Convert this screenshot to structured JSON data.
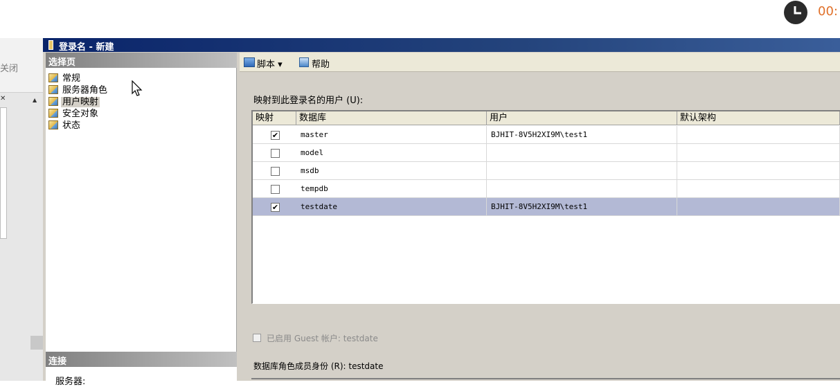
{
  "overlay": {
    "clock_text": "00:"
  },
  "host": {
    "close_label": "关闭",
    "x_label": "✕",
    "scroll_up": "▲"
  },
  "dialog": {
    "title": "登录名 - 新建",
    "select_page_header": "选择页",
    "pages": [
      {
        "label": "常规"
      },
      {
        "label": "服务器角色"
      },
      {
        "label": "用户映射"
      },
      {
        "label": "安全对象"
      },
      {
        "label": "状态"
      }
    ],
    "selected_page": "用户映射",
    "connection_header": "连接",
    "server_label": "服务器:"
  },
  "toolbar": {
    "script_label": "脚本 ▾",
    "help_label": "帮助"
  },
  "mapping": {
    "users_label": "映射到此登录名的用户 (U):",
    "columns": [
      "映射",
      "数据库",
      "用户",
      "默认架构"
    ],
    "rows": [
      {
        "mapped": true,
        "database": "master",
        "user": "BJHIT-8V5H2XI9M\\test1",
        "schema": ""
      },
      {
        "mapped": false,
        "database": "model",
        "user": "",
        "schema": ""
      },
      {
        "mapped": false,
        "database": "msdb",
        "user": "",
        "schema": ""
      },
      {
        "mapped": false,
        "database": "tempdb",
        "user": "",
        "schema": ""
      },
      {
        "mapped": true,
        "database": "testdate",
        "user": "BJHIT-8V5H2XI9M\\test1",
        "schema": ""
      }
    ],
    "selected_row": 4,
    "guest_label": "已启用 Guest 帐户: testdate",
    "role_label": "数据库角色成员身份 (R): testdate"
  },
  "colors": {
    "title_bar": "#0a246a",
    "selection": "#b3b9d5",
    "clock": "#e0712b"
  },
  "icons": [
    "clock-icon",
    "page-icon",
    "script-icon",
    "help-icon",
    "cursor-icon",
    "checkbox-icon"
  ]
}
